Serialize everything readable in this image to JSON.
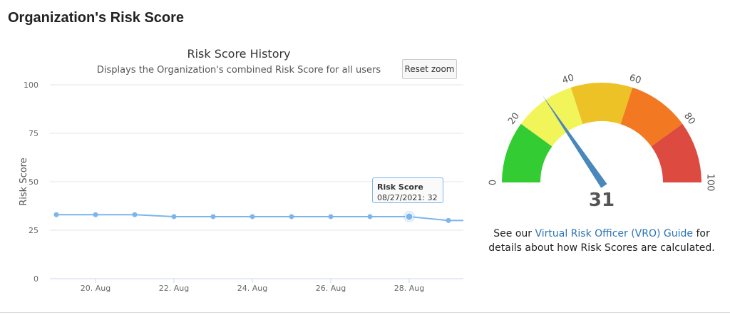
{
  "page": {
    "title": "Organization's Risk Score"
  },
  "history": {
    "reset_zoom_label": "Reset zoom",
    "tooltip": {
      "series": "Risk Score",
      "text": "08/27/2021: 32"
    }
  },
  "chart_data": [
    {
      "type": "line",
      "title": "Risk Score History",
      "subtitle": "Displays the Organization's combined Risk Score for all users",
      "xlabel": "",
      "ylabel": "Risk Score",
      "ylim": [
        0,
        100
      ],
      "yticks": [
        0,
        25,
        50,
        75,
        100
      ],
      "x_tick_labels": [
        "20. Aug",
        "22. Aug",
        "24. Aug",
        "26. Aug",
        "28. Aug"
      ],
      "grid": true,
      "series": [
        {
          "name": "Risk Score",
          "color": "#7cb5ec",
          "points": [
            {
              "date": "2021-08-19",
              "value": 33
            },
            {
              "date": "2021-08-20",
              "value": 33
            },
            {
              "date": "2021-08-21",
              "value": 33
            },
            {
              "date": "2021-08-22",
              "value": 32
            },
            {
              "date": "2021-08-23",
              "value": 32
            },
            {
              "date": "2021-08-24",
              "value": 32
            },
            {
              "date": "2021-08-25",
              "value": 32
            },
            {
              "date": "2021-08-26",
              "value": 32
            },
            {
              "date": "2021-08-27",
              "value": 32
            },
            {
              "date": "2021-08-28",
              "value": 32
            },
            {
              "date": "2021-08-29",
              "value": 30
            },
            {
              "date": "2021-08-30",
              "value": 30
            }
          ]
        }
      ],
      "highlighted_point": "2021-08-28"
    },
    {
      "type": "gauge",
      "value": 31,
      "min": 0,
      "max": 100,
      "tick_labels": [
        "0",
        "20",
        "40",
        "60",
        "80",
        "100"
      ],
      "bands": [
        {
          "from": 0,
          "to": 20,
          "color": "#33cc33"
        },
        {
          "from": 20,
          "to": 40,
          "color": "#f2f55a"
        },
        {
          "from": 40,
          "to": 60,
          "color": "#ecc226"
        },
        {
          "from": 60,
          "to": 80,
          "color": "#f27822"
        },
        {
          "from": 80,
          "to": 100,
          "color": "#dd4a3f"
        }
      ],
      "needle_color": "#4a87bb"
    }
  ],
  "note": {
    "prefix": "See our ",
    "link_text": "Virtual Risk Officer (VRO) Guide",
    "suffix": " for details about how Risk Scores are calculated."
  }
}
